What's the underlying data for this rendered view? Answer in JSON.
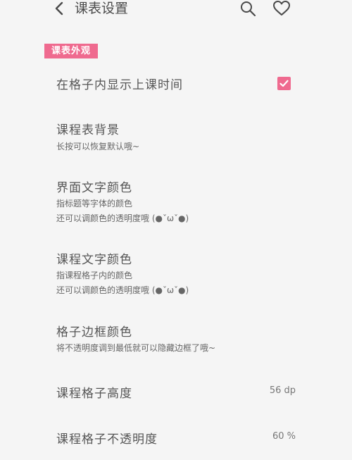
{
  "header": {
    "title": "课表设置",
    "icons": [
      "back-icon",
      "search-icon",
      "heart-icon"
    ]
  },
  "section": {
    "label": "课表外观"
  },
  "colors": {
    "accent": "#ef6a8f",
    "background": "#f5f5f5"
  },
  "settings": [
    {
      "title": "在格子内显示上课时间",
      "checked": true
    },
    {
      "title": "课程表背景",
      "sub1": "长按可以恢复默认哦~"
    },
    {
      "title": "界面文字颜色",
      "sub1": "指标题等字体的颜色",
      "sub2": "还可以调颜色的透明度哦 (●ˇωˇ●)"
    },
    {
      "title": "课程文字颜色",
      "sub1": "指课程格子内的颜色",
      "sub2": "还可以调颜色的透明度哦 (●ˇωˇ●)"
    },
    {
      "title": "格子边框颜色",
      "sub1": "将不透明度调到最低就可以隐藏边框了哦~"
    },
    {
      "title": "课程格子高度",
      "value": "56 dp"
    },
    {
      "title": "课程格子不透明度",
      "value": "60 %"
    }
  ]
}
